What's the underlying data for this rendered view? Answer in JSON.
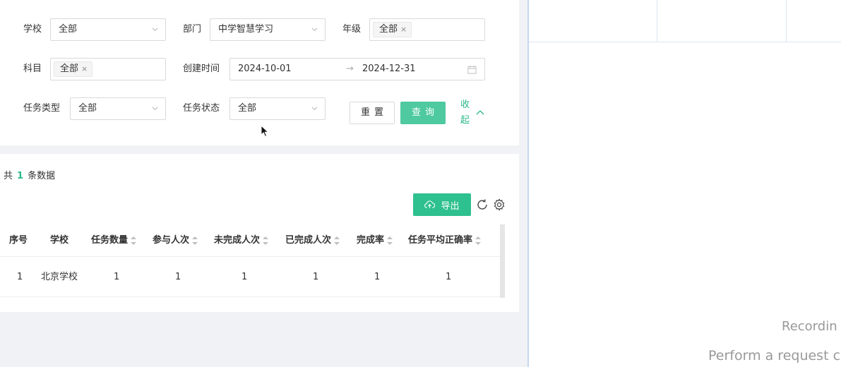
{
  "filters": {
    "school": {
      "label": "学校",
      "value": "全部"
    },
    "department": {
      "label": "部门",
      "value": "中学智慧学习"
    },
    "grade": {
      "label": "年级",
      "tag": "全部",
      "tag_close": "×"
    },
    "subject": {
      "label": "科目",
      "tag": "全部",
      "tag_close": "×"
    },
    "created_time": {
      "label": "创建时间",
      "start": "2024-10-01",
      "separator": "→",
      "end": "2024-12-31"
    },
    "task_type": {
      "label": "任务类型",
      "value": "全部"
    },
    "task_status": {
      "label": "任务状态",
      "value": "全部"
    },
    "reset_label": "重置",
    "query_label": "查询",
    "collapse_label_1": "收",
    "collapse_label_2": "起"
  },
  "summary": {
    "prefix": "共",
    "count": "1",
    "suffix": "条数据"
  },
  "toolbar": {
    "export_label": "导出",
    "refresh_icon": "refresh-icon",
    "settings_icon": "gear-icon"
  },
  "table": {
    "columns": [
      "序号",
      "学校",
      "任务数量",
      "参与人次",
      "未完成人次",
      "已完成人次",
      "完成率",
      "任务平均正确率"
    ],
    "rows": [
      [
        "1",
        "北京学校",
        "1",
        "1",
        "1",
        "1",
        "1",
        "1"
      ]
    ]
  },
  "right_panel": {
    "line1": "Recordin",
    "line2": "Perform a request c"
  },
  "colors": {
    "accent": "#2ec08e",
    "query_button": "#4ec9a0",
    "link": "#2bb88a"
  }
}
